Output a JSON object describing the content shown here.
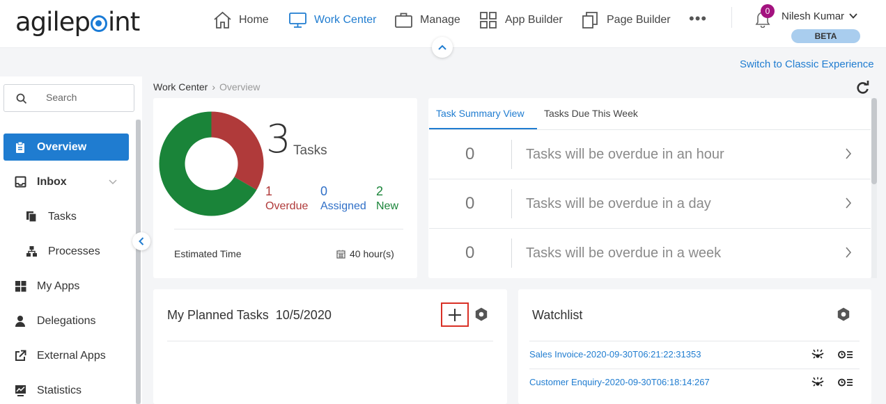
{
  "header": {
    "logo_text": "agilepoint",
    "nav": [
      {
        "label": "Home",
        "icon": "home-icon"
      },
      {
        "label": "Work Center",
        "icon": "monitor-icon",
        "active": true
      },
      {
        "label": "Manage",
        "icon": "briefcase-icon"
      },
      {
        "label": "App Builder",
        "icon": "grid-icon"
      },
      {
        "label": "Page Builder",
        "icon": "pages-icon"
      }
    ],
    "more": "•••",
    "notifications_count": "0",
    "user_name": "Nilesh Kumar",
    "beta_label": "BETA",
    "switch_link": "Switch to Classic Experience"
  },
  "sidebar": {
    "search_placeholder": "Search",
    "items": [
      {
        "label": "Overview",
        "icon": "clipboard-icon",
        "active": true
      },
      {
        "label": "Inbox",
        "icon": "inbox-icon",
        "expandable": true
      },
      {
        "label": "Tasks",
        "icon": "documents-icon",
        "sub": true
      },
      {
        "label": "Processes",
        "icon": "hierarchy-icon",
        "sub": true
      },
      {
        "label": "My Apps",
        "icon": "apps-grid-icon"
      },
      {
        "label": "Delegations",
        "icon": "person-icon"
      },
      {
        "label": "External Apps",
        "icon": "external-link-icon"
      },
      {
        "label": "Statistics",
        "icon": "chart-icon"
      }
    ]
  },
  "breadcrumb": {
    "root": "Work Center",
    "separator": "›",
    "current": "Overview"
  },
  "summary": {
    "total": "3",
    "total_label": "Tasks",
    "overdue_count": "1",
    "overdue_label": "Overdue",
    "assigned_count": "0",
    "assigned_label": "Assigned",
    "new_count": "2",
    "new_label": "New",
    "estimated_label": "Estimated Time",
    "estimated_value": "40 hour(s)",
    "colors": {
      "overdue": "#b03a3a",
      "assigned": "#2f6fc7",
      "new": "#1a8439"
    }
  },
  "chart_data": {
    "type": "pie",
    "variant": "donut",
    "categories": [
      "Overdue",
      "Assigned",
      "New"
    ],
    "values": [
      1,
      0,
      2
    ],
    "colors": [
      "#b03a3a",
      "#2f6fc7",
      "#1a8439"
    ]
  },
  "task_view": {
    "tabs": [
      {
        "label": "Task Summary View",
        "active": true
      },
      {
        "label": "Tasks Due This Week"
      }
    ],
    "rows": [
      {
        "count": "0",
        "text": "Tasks will be overdue in an hour"
      },
      {
        "count": "0",
        "text": "Tasks will be overdue in a day"
      },
      {
        "count": "0",
        "text": "Tasks will be overdue in a week"
      }
    ]
  },
  "planned": {
    "title": "My Planned Tasks",
    "date": "10/5/2020"
  },
  "watchlist": {
    "title": "Watchlist",
    "items": [
      {
        "label": "Sales Invoice-2020-09-30T06:21:22:31353"
      },
      {
        "label": "Customer Enquiry-2020-09-30T06:18:14:267"
      }
    ]
  }
}
